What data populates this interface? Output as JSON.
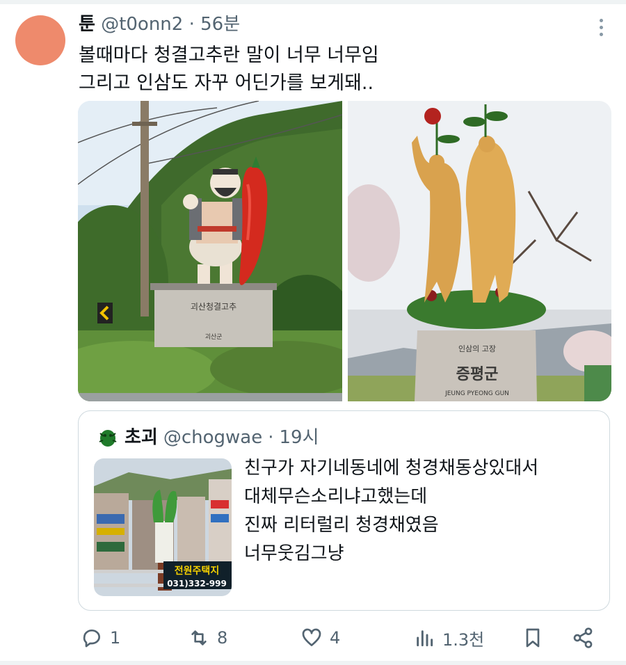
{
  "tweet": {
    "author_name": "툰",
    "handle": "@t0onn2",
    "separator": "·",
    "time": "56분",
    "avatar_color": "#ee8a6c",
    "text_lines": [
      "볼때마다 청결고추란 말이 너무 너무임",
      "그리고 인삼도 자꾸 어딘가를 보게돼.."
    ],
    "images": {
      "left": {
        "subject": "giant chili pepper and farmer statue",
        "plaque_text": "괴산청결고추",
        "plaque_sub": "괴산군"
      },
      "right": {
        "subject": "ginseng root figures statue",
        "plaque_top": "인삼의 고장",
        "plaque_main": "증평군",
        "plaque_en": "JEUNG PYEONG GUN"
      }
    }
  },
  "quote": {
    "author_name": "초괴",
    "handle": "@chogwae",
    "separator": "·",
    "time": "19시",
    "text_lines": [
      "친구가 자기네동네에 청경채동상있대서",
      "대체무슨소리냐고했는데",
      "진짜 리터럴리 청경채였음",
      "너무웃김그냥"
    ],
    "thumbnail": {
      "subject": "bok choy statue in town",
      "sign_text": "전원주택지",
      "sign_phone": "031)332-999"
    }
  },
  "actions": {
    "reply_count": "1",
    "retweet_count": "8",
    "like_count": "4",
    "views_count": "1.3천"
  },
  "colors": {
    "muted": "#536471",
    "border": "#cfd9de",
    "text": "#0f1419"
  }
}
